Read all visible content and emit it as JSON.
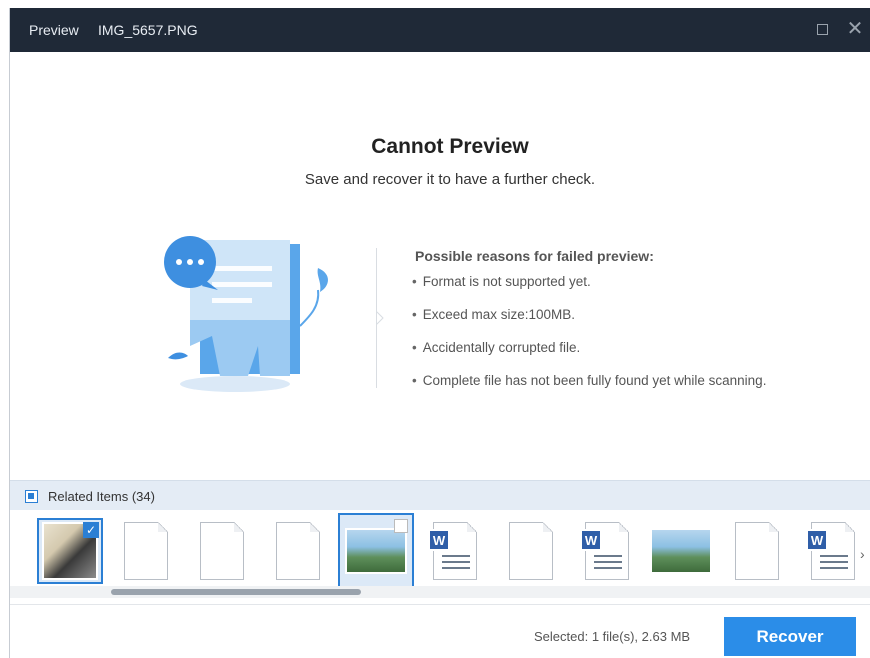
{
  "titlebar": {
    "title": "Preview",
    "filename": "IMG_5657.PNG"
  },
  "message": {
    "heading": "Cannot Preview",
    "subheading": "Save and recover it to have a further check."
  },
  "reasons": {
    "title": "Possible reasons for failed preview:",
    "items": [
      "Format is not supported yet.",
      "Exceed max size:100MB.",
      "Accidentally corrupted file.",
      "Complete file has not been fully found yet while scanning."
    ]
  },
  "related": {
    "label": "Related Items (34)"
  },
  "thumbnails": [
    {
      "kind": "photo",
      "selected": true,
      "checked": true
    },
    {
      "kind": "blank"
    },
    {
      "kind": "blank"
    },
    {
      "kind": "blank"
    },
    {
      "kind": "photo",
      "current": true
    },
    {
      "kind": "word"
    },
    {
      "kind": "blank"
    },
    {
      "kind": "word"
    },
    {
      "kind": "photo"
    },
    {
      "kind": "blank"
    },
    {
      "kind": "word"
    }
  ],
  "footer": {
    "selected_text": "Selected: 1 file(s), 2.63 MB",
    "recover_label": "Recover"
  },
  "colors": {
    "accent": "#2b8de8",
    "titlebar": "#1f2937"
  }
}
